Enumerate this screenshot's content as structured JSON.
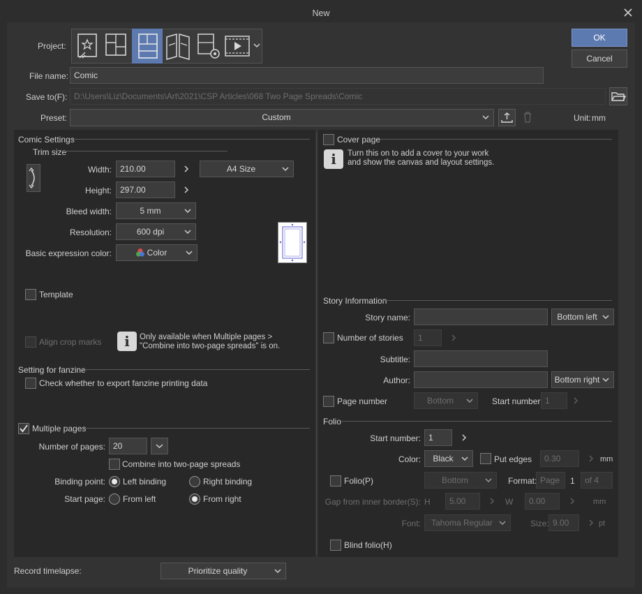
{
  "window": {
    "title": "New"
  },
  "header": {
    "project_label": "Project:",
    "ok": "OK",
    "cancel": "Cancel",
    "file_name_label": "File name:",
    "file_name_value": "Comic",
    "save_to_label": "Save to(F):",
    "save_to_value": "D:\\Users\\Liz\\Documents\\Art\\2021\\CSP Articles\\068 Two Page Spreads\\Comic",
    "preset_label": "Preset:",
    "preset_value": "Custom",
    "unit_label": "Unit:",
    "unit_value": "mm"
  },
  "project_types": [
    {
      "icon": "illustration-icon",
      "selected": false
    },
    {
      "icon": "webtoon-icon",
      "selected": false
    },
    {
      "icon": "comic-icon",
      "selected": true
    },
    {
      "icon": "show-all-comic-settings-icon",
      "selected": false
    },
    {
      "icon": "custom-settings-icon",
      "selected": false
    },
    {
      "icon": "animation-icon",
      "selected": false
    }
  ],
  "comic_settings": {
    "heading": "Comic Settings",
    "trim_size": "Trim size",
    "width_label": "Width:",
    "width_value": "210.00",
    "height_label": "Height:",
    "height_value": "297.00",
    "size_preset": "A4 Size",
    "bleed_label": "Bleed width:",
    "bleed_value": "5 mm",
    "resolution_label": "Resolution:",
    "resolution_value": "600 dpi",
    "color_label": "Basic expression color:",
    "color_value": "Color",
    "template": "Template",
    "align_crop": "Align crop marks",
    "crop_info_1": "Only available when Multiple pages >",
    "crop_info_2": "\"Combine into two-page spreads\" is on."
  },
  "fanzine": {
    "heading": "Setting for fanzine",
    "export_check": "Check whether to export fanzine printing data"
  },
  "multiple_pages": {
    "label": "Multiple pages",
    "checked": true,
    "num_label": "Number of pages:",
    "num_value": "20",
    "combine": "Combine into two-page spreads",
    "binding_label": "Binding point:",
    "left_binding": "Left binding",
    "right_binding": "Right binding",
    "start_label": "Start page:",
    "from_left": "From left",
    "from_right": "From right"
  },
  "cover": {
    "label": "Cover page",
    "info_1": "Turn this on to add a cover to your work",
    "info_2": "and show the canvas and layout settings."
  },
  "story": {
    "heading": "Story Information",
    "story_name_label": "Story name:",
    "story_pos": "Bottom left",
    "num_stories": "Number of stories",
    "num_stories_value": "1",
    "subtitle_label": "Subtitle:",
    "author_label": "Author:",
    "author_pos": "Bottom right",
    "page_number": "Page number",
    "page_number_pos": "Bottom",
    "start_number_label": "Start number:",
    "start_number_value": "1"
  },
  "folio": {
    "heading": "Folio",
    "start_label": "Start number:",
    "start_value": "1",
    "color_label": "Color:",
    "color_value": "Black",
    "put_edges": "Put edges",
    "edges_value": "0.30",
    "edges_unit": "mm",
    "folio_p": "Folio(P)",
    "folio_pos": "Bottom",
    "format_label": "Format:",
    "format_page": "Page",
    "format_num": "1",
    "format_of": "of 4",
    "gap_label": "Gap from inner border(S):",
    "h_label": "H",
    "h_value": "5.00",
    "w_label": "W",
    "w_value": "0.00",
    "gap_unit": "mm",
    "font_label": "Font:",
    "font_value": "Tahoma Regular",
    "size_label": "Size:",
    "size_value": "9.00",
    "size_unit": "pt",
    "blind": "Blind folio(H)"
  },
  "footer": {
    "timelapse_label": "Record timelapse:",
    "timelapse_value": "Prioritize quality"
  }
}
